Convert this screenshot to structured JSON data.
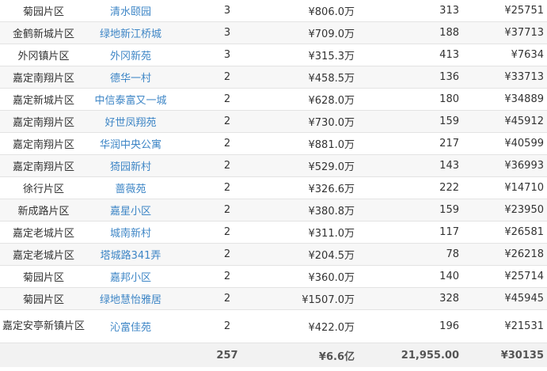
{
  "rows": [
    {
      "district": "菊园片区",
      "community": "清水颐园",
      "listings": "3",
      "total_price": "¥806.0万",
      "count": "313",
      "avg_price": "¥25751"
    },
    {
      "district": "金鹤新城片区",
      "community": "绿地新江桥城",
      "listings": "3",
      "total_price": "¥709.0万",
      "count": "188",
      "avg_price": "¥37713"
    },
    {
      "district": "外冈镇片区",
      "community": "外冈新苑",
      "listings": "3",
      "total_price": "¥315.3万",
      "count": "413",
      "avg_price": "¥7634"
    },
    {
      "district": "嘉定南翔片区",
      "community": "德华一村",
      "listings": "2",
      "total_price": "¥458.5万",
      "count": "136",
      "avg_price": "¥33713"
    },
    {
      "district": "嘉定新城片区",
      "community": "中信泰富又一城",
      "listings": "2",
      "total_price": "¥628.0万",
      "count": "180",
      "avg_price": "¥34889"
    },
    {
      "district": "嘉定南翔片区",
      "community": "好世凤翔苑",
      "listings": "2",
      "total_price": "¥730.0万",
      "count": "159",
      "avg_price": "¥45912"
    },
    {
      "district": "嘉定南翔片区",
      "community": "华润中央公寓",
      "listings": "2",
      "total_price": "¥881.0万",
      "count": "217",
      "avg_price": "¥40599"
    },
    {
      "district": "嘉定南翔片区",
      "community": "猗园新村",
      "listings": "2",
      "total_price": "¥529.0万",
      "count": "143",
      "avg_price": "¥36993"
    },
    {
      "district": "徐行片区",
      "community": "蔷薇苑",
      "listings": "2",
      "total_price": "¥326.6万",
      "count": "222",
      "avg_price": "¥14710"
    },
    {
      "district": "新成路片区",
      "community": "嘉星小区",
      "listings": "2",
      "total_price": "¥380.8万",
      "count": "159",
      "avg_price": "¥23950"
    },
    {
      "district": "嘉定老城片区",
      "community": "城南新村",
      "listings": "2",
      "total_price": "¥311.0万",
      "count": "117",
      "avg_price": "¥26581"
    },
    {
      "district": "嘉定老城片区",
      "community": "塔城路341弄",
      "listings": "2",
      "total_price": "¥204.5万",
      "count": "78",
      "avg_price": "¥26218"
    },
    {
      "district": "菊园片区",
      "community": "嘉邦小区",
      "listings": "2",
      "total_price": "¥360.0万",
      "count": "140",
      "avg_price": "¥25714"
    },
    {
      "district": "菊园片区",
      "community": "绿地慧怡雅居",
      "listings": "2",
      "total_price": "¥1507.0万",
      "count": "328",
      "avg_price": "¥45945"
    },
    {
      "district": "嘉定安亭新镇片区",
      "community": "沁富佳苑",
      "listings": "2",
      "total_price": "¥422.0万",
      "count": "196",
      "avg_price": "¥21531"
    }
  ],
  "totals": {
    "district": "",
    "community": "",
    "listings": "257",
    "total_price": "¥6.6亿",
    "count": "21,955.00",
    "avg_price": "¥30135"
  }
}
